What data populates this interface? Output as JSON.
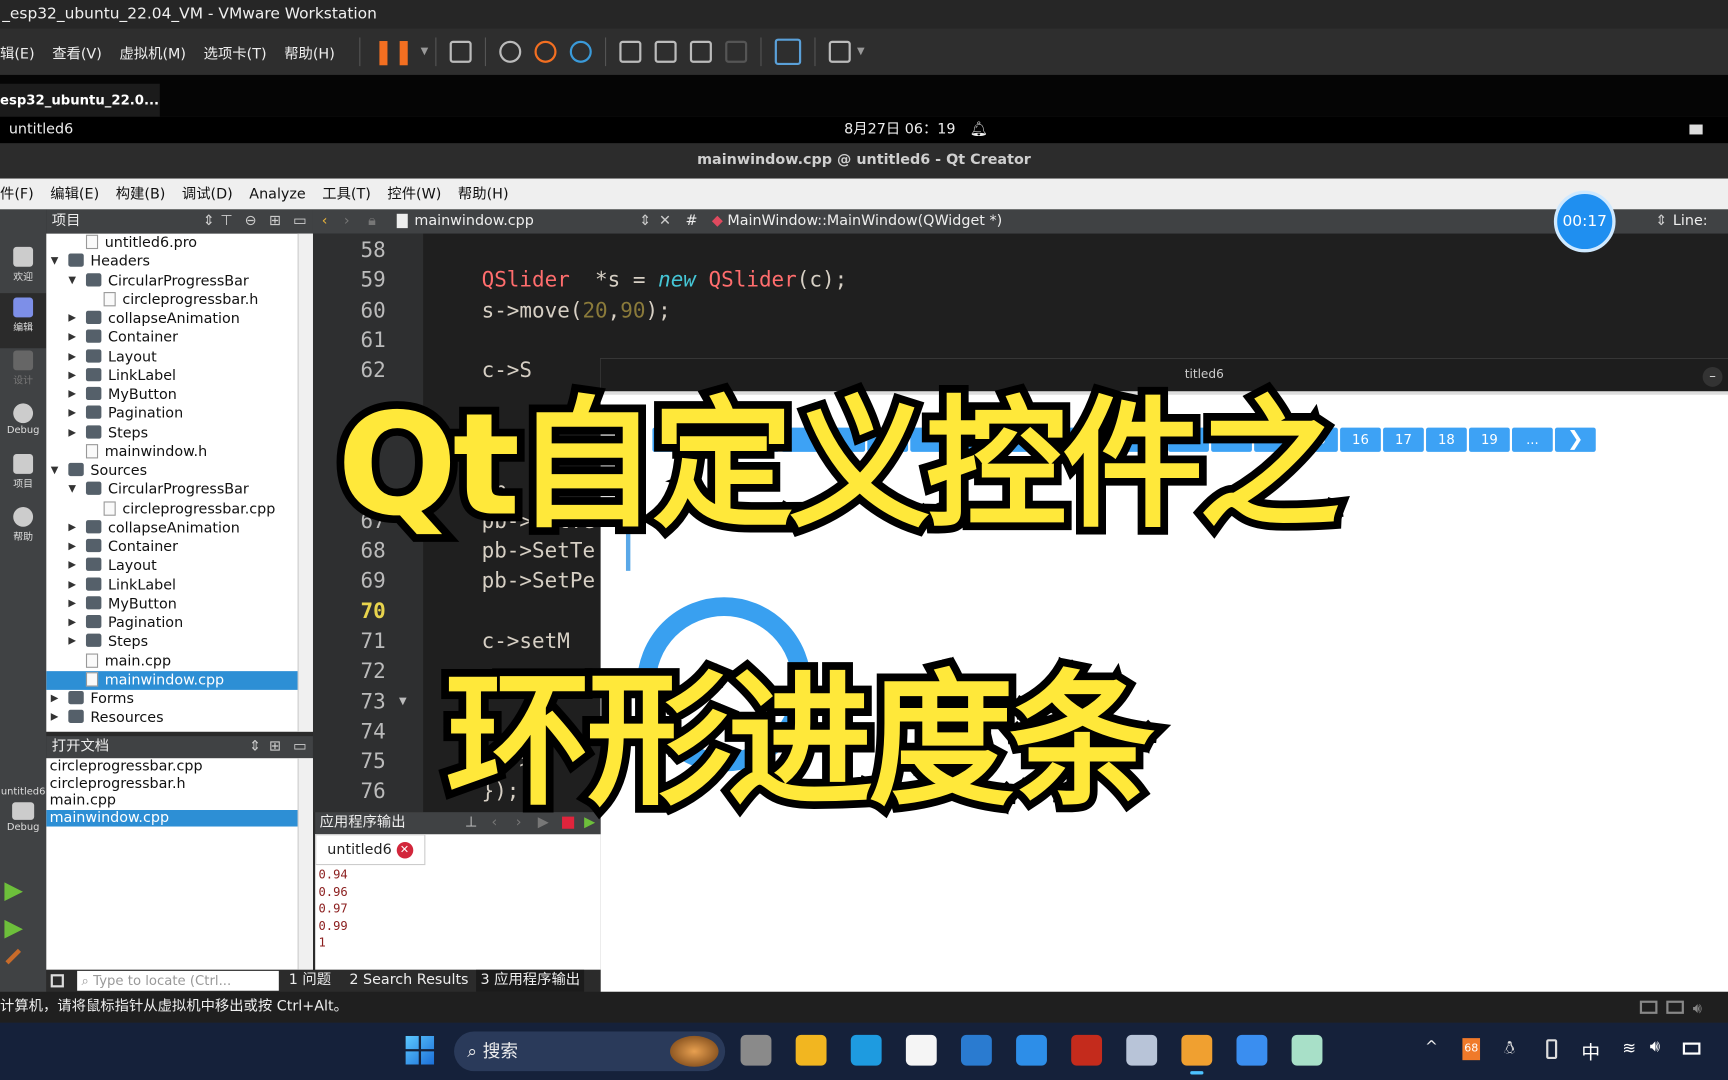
{
  "vmware": {
    "title": "_esp32_ubuntu_22.04_VM - VMware Workstation",
    "menu": [
      "辑(E)",
      "查看(V)",
      "虚拟机(M)",
      "选项卡(T)",
      "帮助(H)"
    ],
    "tab": "esp32_ubuntu_22.0...",
    "tab_close": "✕",
    "status": "计算机，请将鼠标指针从虚拟机中移出或按 Ctrl+Alt。"
  },
  "ubuntu": {
    "app": "untitled6",
    "datetime": "8月27日  06：19"
  },
  "qt": {
    "title": "mainwindow.cpp @ untitled6 - Qt Creator",
    "menu": [
      "件(F)",
      "编辑(E)",
      "构建(B)",
      "调试(D)",
      "Analyze",
      "工具(T)",
      "控件(W)",
      "帮助(H)"
    ],
    "modes": [
      "欢迎",
      "编辑",
      "设计",
      "Debug",
      "项目",
      "帮助"
    ],
    "kit": "untitled6",
    "kit_mode": "Debug",
    "project_header": "项目",
    "tree": [
      {
        "label": "untitled6.pro",
        "depth": 1,
        "type": "file"
      },
      {
        "label": "Headers",
        "depth": 0,
        "type": "folder",
        "open": true
      },
      {
        "label": "CircularProgressBar",
        "depth": 1,
        "type": "folder",
        "open": true
      },
      {
        "label": "circleprogressbar.h",
        "depth": 2,
        "type": "file"
      },
      {
        "label": "collapseAnimation",
        "depth": 1,
        "type": "folder"
      },
      {
        "label": "Container",
        "depth": 1,
        "type": "folder"
      },
      {
        "label": "Layout",
        "depth": 1,
        "type": "folder"
      },
      {
        "label": "LinkLabel",
        "depth": 1,
        "type": "folder"
      },
      {
        "label": "MyButton",
        "depth": 1,
        "type": "folder"
      },
      {
        "label": "Pagination",
        "depth": 1,
        "type": "folder"
      },
      {
        "label": "Steps",
        "depth": 1,
        "type": "folder"
      },
      {
        "label": "mainwindow.h",
        "depth": 1,
        "type": "file"
      },
      {
        "label": "Sources",
        "depth": 0,
        "type": "folder",
        "open": true
      },
      {
        "label": "CircularProgressBar",
        "depth": 1,
        "type": "folder",
        "open": true
      },
      {
        "label": "circleprogressbar.cpp",
        "depth": 2,
        "type": "file"
      },
      {
        "label": "collapseAnimation",
        "depth": 1,
        "type": "folder"
      },
      {
        "label": "Container",
        "depth": 1,
        "type": "folder"
      },
      {
        "label": "Layout",
        "depth": 1,
        "type": "folder"
      },
      {
        "label": "LinkLabel",
        "depth": 1,
        "type": "folder"
      },
      {
        "label": "MyButton",
        "depth": 1,
        "type": "folder"
      },
      {
        "label": "Pagination",
        "depth": 1,
        "type": "folder"
      },
      {
        "label": "Steps",
        "depth": 1,
        "type": "folder"
      },
      {
        "label": "main.cpp",
        "depth": 1,
        "type": "file"
      },
      {
        "label": "mainwindow.cpp",
        "depth": 1,
        "type": "file",
        "selected": true
      },
      {
        "label": "Forms",
        "depth": 0,
        "type": "folder"
      },
      {
        "label": "Resources",
        "depth": 0,
        "type": "folder"
      }
    ],
    "open_docs_header": "打开文档",
    "open_docs": [
      {
        "label": "circleprogressbar.cpp"
      },
      {
        "label": "circleprogressbar.h"
      },
      {
        "label": "main.cpp"
      },
      {
        "label": "mainwindow.cpp",
        "selected": true
      }
    ],
    "editor": {
      "file": "mainwindow.cpp",
      "hash": "#",
      "symbol": "MainWindow::MainWindow(QWidget *)",
      "line_info": "Line: 70",
      "line_numbers": [
        "58",
        "59",
        "60",
        "61",
        "62",
        "",
        "",
        "",
        "66",
        "67",
        "68",
        "69",
        "70",
        "71",
        "72",
        "73",
        "74",
        "75",
        "76"
      ],
      "current_line": "70",
      "lines": [
        {
          "n": "59",
          "parts": [
            [
              "kw",
              "QSlider"
            ],
            [
              "",
              "  *s = "
            ],
            [
              "it",
              "new"
            ],
            [
              "kw",
              " QSlider"
            ],
            [
              "",
              "(c);"
            ]
          ]
        },
        {
          "n": "60",
          "parts": [
            [
              "",
              "s->move("
            ],
            [
              "num",
              "20"
            ],
            [
              "",
              ","
            ],
            [
              "num",
              "90"
            ],
            [
              "",
              ");"
            ]
          ]
        },
        {
          "n": "62",
          "parts": [
            [
              "",
              "c->S"
            ]
          ]
        },
        {
          "n": "66",
          "parts": [
            [
              "",
              "pb-"
            ]
          ]
        },
        {
          "n": "67",
          "parts": [
            [
              "",
              "pb->SetTe"
            ]
          ]
        },
        {
          "n": "68",
          "parts": [
            [
              "",
              "pb->SetTe"
            ]
          ]
        },
        {
          "n": "69",
          "parts": [
            [
              "",
              "pb->SetPe"
            ]
          ]
        },
        {
          "n": "71",
          "parts": [
            [
              "",
              "c->setM"
            ]
          ]
        },
        {
          "n": "75",
          "parts": [
            [
              "",
              "  ->"
            ]
          ]
        },
        {
          "n": "76",
          "parts": [
            [
              "",
              "});"
            ]
          ]
        }
      ]
    },
    "output": {
      "header": "应用程序输出",
      "tab": "untitled6",
      "lines": [
        "0.94",
        "0.96",
        "0.97",
        "0.99",
        "1"
      ]
    },
    "status_bar": {
      "locate_placeholder": "Type to locate (Ctrl...",
      "tabs": [
        "1 问题",
        "2 Search Results",
        "3 应用程序输出"
      ]
    },
    "timer": "00:17"
  },
  "app_window": {
    "title": "titled6",
    "pagination": [
      "",
      "",
      "",
      "",
      "",
      "5",
      "",
      "",
      "",
      "",
      "",
      "",
      "",
      "",
      "",
      "15",
      "16",
      "17",
      "18",
      "19",
      "...",
      "❯"
    ],
    "ring_progress": 1,
    "accent": "#3da2f5"
  },
  "overlay": {
    "line1": "Qt自定义控件之",
    "line2": "环形进度条",
    "color": "#ffe83a"
  },
  "taskbar": {
    "search": "搜索",
    "tray_badge": "68",
    "ime": "中",
    "icons": [
      "windows-start",
      "task-view",
      "file-explorer",
      "edge",
      "store",
      "settings",
      "vscode",
      "filezilla",
      "remote-desktop",
      "vmware",
      "headphones",
      "app"
    ]
  }
}
